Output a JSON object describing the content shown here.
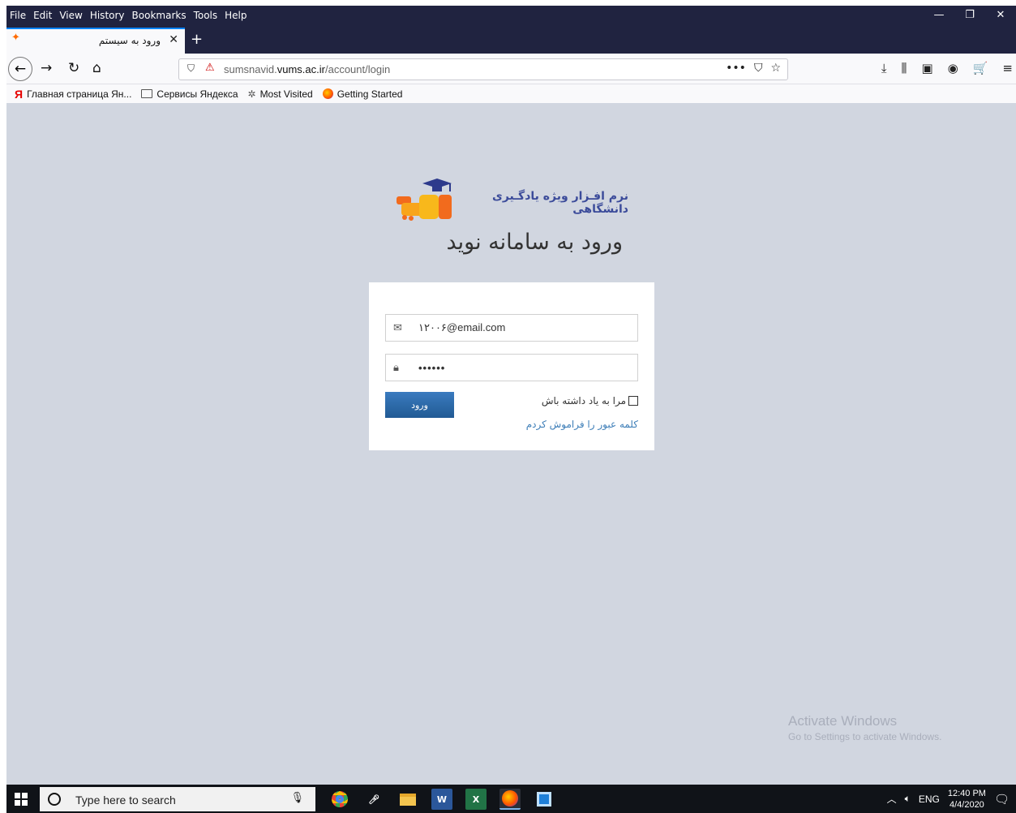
{
  "browser": {
    "menu": [
      "File",
      "Edit",
      "View",
      "History",
      "Bookmarks",
      "Tools",
      "Help"
    ],
    "window_controls": [
      "—",
      "❐",
      "✕"
    ],
    "tab": {
      "title": "ورود به سیستم",
      "close": "✕"
    },
    "new_tab": "+",
    "url_host": "sumsnavid.",
    "url_domain": "vums.ac.ir",
    "url_path": "/account/login",
    "page_actions": [
      "•••",
      "⛉",
      "☆"
    ],
    "toolbar_icons": [
      "⤓",
      "⫼",
      "▣",
      "◉",
      "🛒",
      "≡"
    ]
  },
  "bookmarks": [
    {
      "label": "Главная страница Ян...",
      "icon": "yandex-icon"
    },
    {
      "label": "Сервисы Яндекса",
      "icon": "folder-icon"
    },
    {
      "label": "Most Visited",
      "icon": "gear-icon"
    },
    {
      "label": "Getting Started",
      "icon": "firefox-icon"
    }
  ],
  "login": {
    "logo_text": "نرم افـزار ویژه یادگـیری دانشگاهی",
    "heading": "ورود به سامانه نوید",
    "email_value": "۱۲۰۰۶@email.com",
    "password_value": "••••••",
    "login_button": "ورود",
    "remember_me": "مرا به یاد داشته باش",
    "forgot_password": "کلمه عبور را فراموش کردم"
  },
  "watermark": {
    "title": "Activate Windows",
    "subtitle": "Go to Settings to activate Windows."
  },
  "taskbar": {
    "search_placeholder": "Type here to search",
    "language": "ENG",
    "time": "12:40 PM",
    "date": "4/4/2020"
  },
  "colors": {
    "page_background": "#d1d6e0",
    "login_button": "#2a63a0",
    "link": "#3f7fb8",
    "titlebar": "#202340"
  }
}
